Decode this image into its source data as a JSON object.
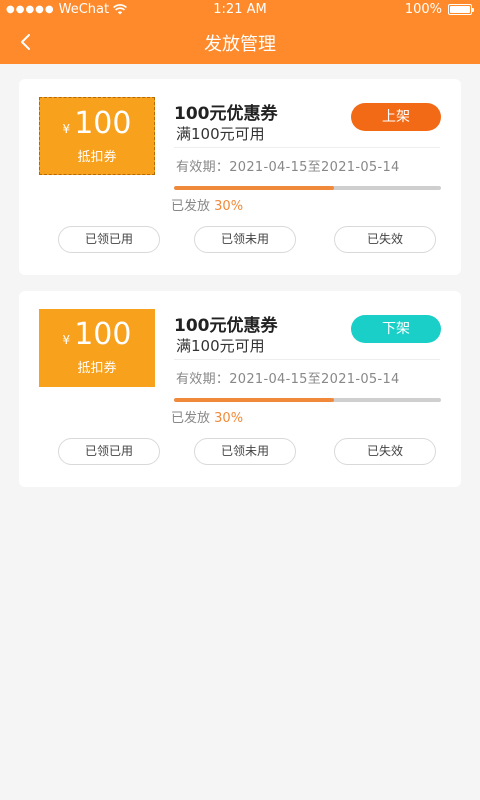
{
  "status_bar": {
    "carrier": "WeChat",
    "time": "1:21 AM",
    "battery": "100%"
  },
  "header": {
    "title": "发放管理",
    "back_icon": "chevron-left-icon"
  },
  "colors": {
    "brand": "#fe8a2b",
    "coupon": "#f7a11d",
    "on_shelf_btn": "#f26a16",
    "off_shelf_btn": "#19cfc7",
    "progress": "#f08a3a"
  },
  "coupons": [
    {
      "currency": "¥",
      "amount": "100",
      "type_label": "抵扣券",
      "title": "100元优惠券",
      "condition": "满100元可用",
      "validity": "有效期：2021-04-15至2021-05-14",
      "action_label": "上架",
      "issued_label": "已发放",
      "issued_percent": "30%",
      "progress_percent": 60,
      "filters": [
        "已领已用",
        "已领未用",
        "已失效"
      ]
    },
    {
      "currency": "¥",
      "amount": "100",
      "type_label": "抵扣券",
      "title": "100元优惠券",
      "condition": "满100元可用",
      "validity": "有效期：2021-04-15至2021-05-14",
      "action_label": "下架",
      "issued_label": "已发放",
      "issued_percent": "30%",
      "progress_percent": 60,
      "filters": [
        "已领已用",
        "已领未用",
        "已失效"
      ]
    }
  ]
}
